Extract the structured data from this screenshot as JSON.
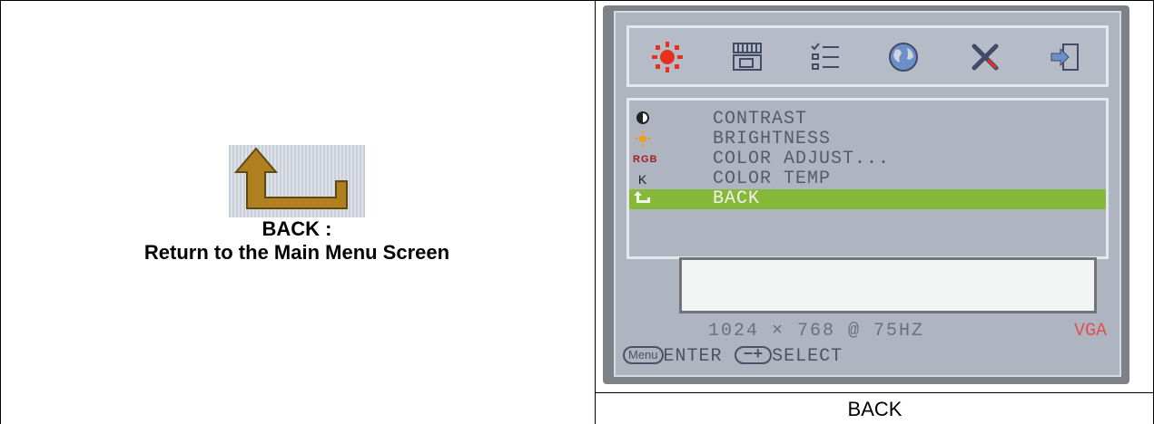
{
  "left": {
    "title": "BACK :",
    "description": "Return to the Main Menu Screen",
    "icon": "back-arrow-icon"
  },
  "osd": {
    "toolbar_icons": [
      "sun-icon",
      "picture-position-icon",
      "checklist-icon",
      "globe-icon",
      "tools-icon",
      "exit-icon"
    ],
    "menu_items": [
      {
        "label": "CONTRAST",
        "icon": "contrast-icon",
        "selected": false
      },
      {
        "label": "BRIGHTNESS",
        "icon": "brightness-icon",
        "selected": false
      },
      {
        "label": "COLOR ADJUST...",
        "icon": "rgb-icon",
        "selected": false
      },
      {
        "label": "COLOR TEMP",
        "icon": "thermometer-icon",
        "selected": false
      },
      {
        "label": "BACK",
        "icon": "back-arrow-icon",
        "selected": true
      }
    ],
    "rgb_label": "RGB",
    "temp_label": "K",
    "resolution": "1024 × 768 @ 75HZ",
    "input": "VGA",
    "menu_button": "Menu",
    "enter_label": "ENTER",
    "select_button": "−+",
    "select_label": "SELECT"
  },
  "caption": "BACK",
  "colors": {
    "selected_row": "#86b93a",
    "vga": "#e05050",
    "osd_bg": "#aeb4c0"
  }
}
